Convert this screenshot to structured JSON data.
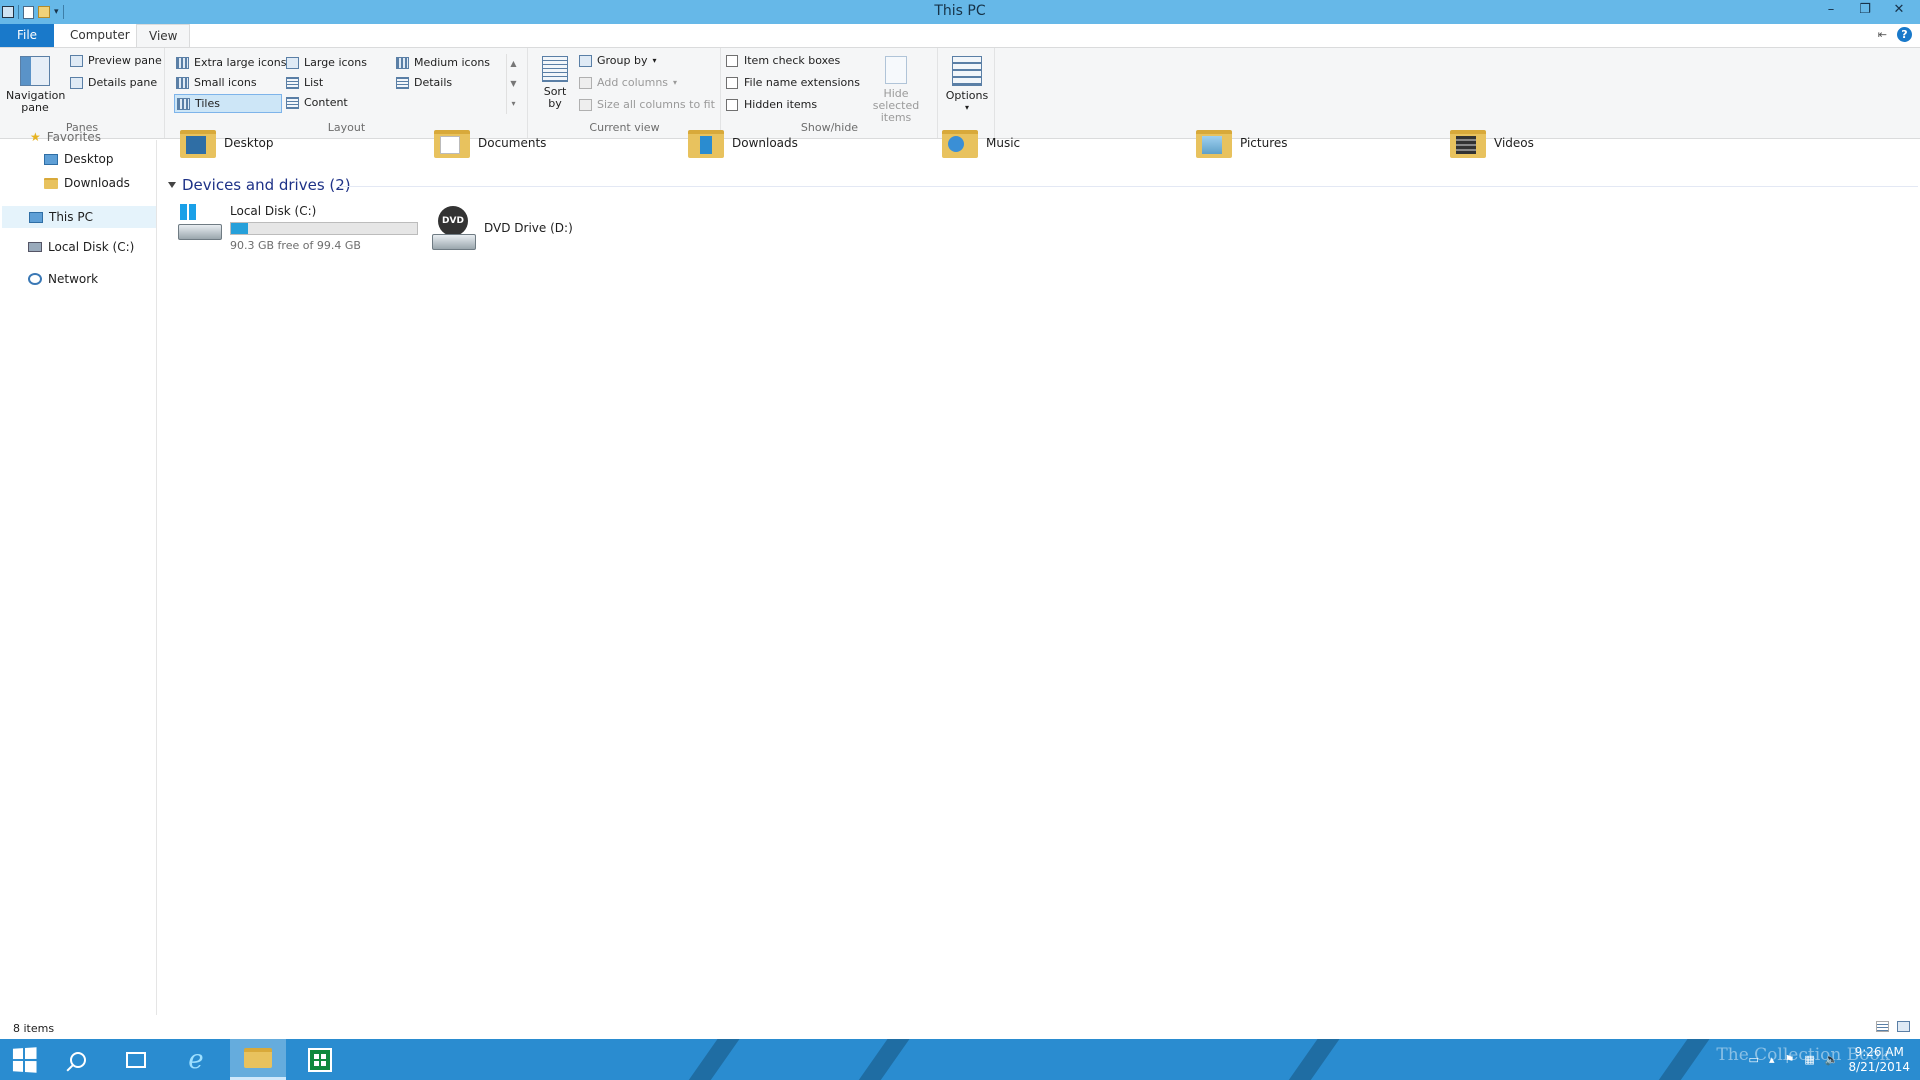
{
  "window": {
    "title": "This PC",
    "minimize": "–",
    "restore": "❐",
    "close": "✕"
  },
  "tabs": {
    "file": "File",
    "computer": "Computer",
    "view": "View"
  },
  "ribbon": {
    "panes": {
      "title": "Panes",
      "navigation_pane": "Navigation pane",
      "preview_pane": "Preview pane",
      "details_pane": "Details pane"
    },
    "layout": {
      "title": "Layout",
      "extra_large_icons": "Extra large icons",
      "large_icons": "Large icons",
      "medium_icons": "Medium icons",
      "small_icons": "Small icons",
      "list": "List",
      "details": "Details",
      "tiles": "Tiles",
      "content": "Content"
    },
    "current_view": {
      "title": "Current view",
      "sort_by": "Sort by",
      "group_by": "Group by",
      "add_columns": "Add columns",
      "size_all_columns": "Size all columns to fit"
    },
    "show_hide": {
      "title": "Show/hide",
      "item_check_boxes": "Item check boxes",
      "file_name_extensions": "File name extensions",
      "hidden_items": "Hidden items",
      "hide_selected_items": "Hide selected items"
    },
    "options": "Options"
  },
  "navpane": {
    "favorites": "Favorites",
    "items": [
      {
        "label": "Desktop"
      },
      {
        "label": "Downloads"
      },
      {
        "label": "This PC"
      },
      {
        "label": "Local Disk (C:)"
      },
      {
        "label": "Network"
      }
    ]
  },
  "content": {
    "folders": [
      "Desktop",
      "Documents",
      "Downloads",
      "Music",
      "Pictures",
      "Videos"
    ],
    "devices_header": "Devices and drives (2)",
    "drives": [
      {
        "name": "Local Disk (C:)",
        "free_text": "90.3 GB free of 99.4 GB",
        "used_fraction": 0.09
      },
      {
        "name": "DVD Drive (D:)"
      }
    ]
  },
  "status": {
    "items_count": "8 items"
  },
  "taskbar": {
    "time": "9:26 AM",
    "date": "8/21/2014",
    "watermark": "The Collection Book"
  },
  "colors": {
    "title_bar": "#66b8e8",
    "file_tab": "#1979ca",
    "taskbar": "#2a8cd0",
    "progress_fill": "#26a0da",
    "section_header": "#1e3287"
  }
}
